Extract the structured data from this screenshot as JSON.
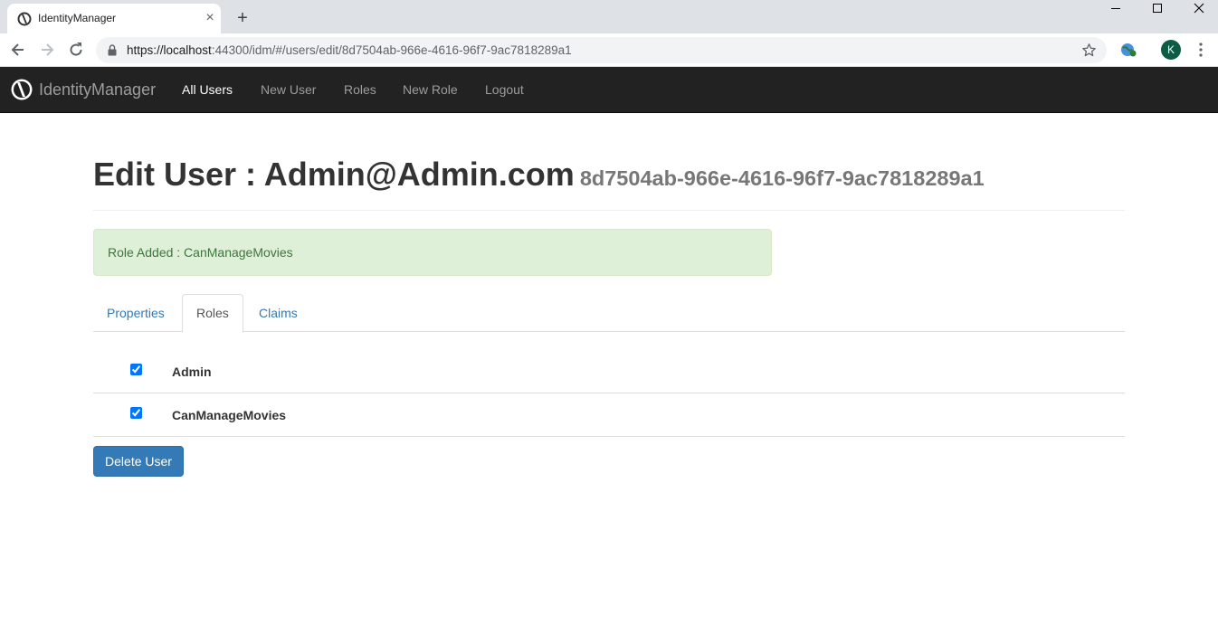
{
  "browser": {
    "tab_title": "IdentityManager",
    "url_host": "https://localhost",
    "url_rest": ":44300/idm/#/users/edit/8d7504ab-966e-4616-96f7-9ac7818289a1",
    "profile_initial": "K"
  },
  "navbar": {
    "brand": "IdentityManager",
    "links": [
      {
        "label": "All Users",
        "active": true
      },
      {
        "label": "New User",
        "active": false
      },
      {
        "label": "Roles",
        "active": false
      },
      {
        "label": "New Role",
        "active": false
      },
      {
        "label": "Logout",
        "active": false
      }
    ]
  },
  "page": {
    "title": "Edit User : Admin@Admin.com",
    "subtitle": "8d7504ab-966e-4616-96f7-9ac7818289a1"
  },
  "alert": {
    "text": "Role Added : CanManageMovies"
  },
  "tabs": [
    {
      "label": "Properties",
      "active": false
    },
    {
      "label": "Roles",
      "active": true
    },
    {
      "label": "Claims",
      "active": false
    }
  ],
  "roles": [
    {
      "name": "Admin",
      "checked": true
    },
    {
      "name": "CanManageMovies",
      "checked": true
    }
  ],
  "actions": {
    "delete_label": "Delete User"
  },
  "colors": {
    "navbar_bg": "#222222",
    "alert_bg": "#dff0d8",
    "primary": "#337ab7"
  }
}
